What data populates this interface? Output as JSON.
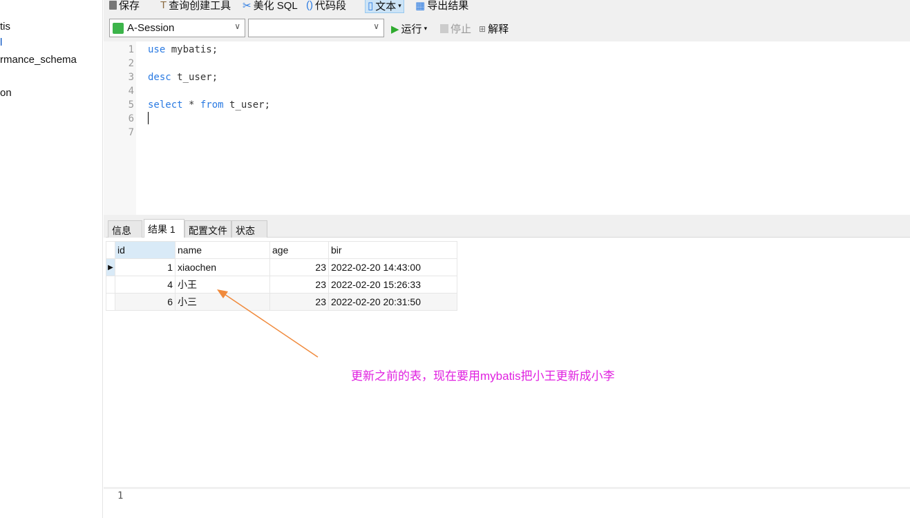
{
  "sidebar": {
    "items": [
      "tis",
      "l",
      "rmance_schema",
      "on"
    ]
  },
  "toolbar": {
    "save": "保存",
    "query_builder": "查询创建工具",
    "beautify": "美化 SQL",
    "snippet": "代码段",
    "text": "文本",
    "export": "导出结果",
    "session": "A-Session",
    "database": "",
    "run": "运行",
    "stop": "停止",
    "explain": "解释"
  },
  "editor": {
    "line_numbers": [
      "1",
      "2",
      "3",
      "4",
      "5",
      "6",
      "7"
    ],
    "lines": [
      [
        "use",
        " mybatis;"
      ],
      [
        "",
        ""
      ],
      [
        "desc",
        " t_user;"
      ],
      [
        "",
        ""
      ],
      [
        "select",
        " * ",
        "from",
        " t_user;"
      ],
      [
        "",
        ""
      ],
      [
        "",
        ""
      ]
    ]
  },
  "tabs": [
    "信息",
    "结果 1",
    "配置文件",
    "状态"
  ],
  "results": {
    "columns": [
      "id",
      "name",
      "age",
      "bir"
    ],
    "rows": [
      [
        "1",
        "xiaochen",
        "23",
        "2022-02-20 14:43:00"
      ],
      [
        "4",
        "小王",
        "23",
        "2022-02-20 15:26:33"
      ],
      [
        "6",
        "小三",
        "23",
        "2022-02-20 20:31:50"
      ]
    ]
  },
  "annotation": {
    "text": "更新之前的表，现在要用mybatis把小王更新成小李",
    "color": "#e020e0",
    "arrow_color": "#f08a3c"
  },
  "bottom": {
    "line_number": "1"
  }
}
